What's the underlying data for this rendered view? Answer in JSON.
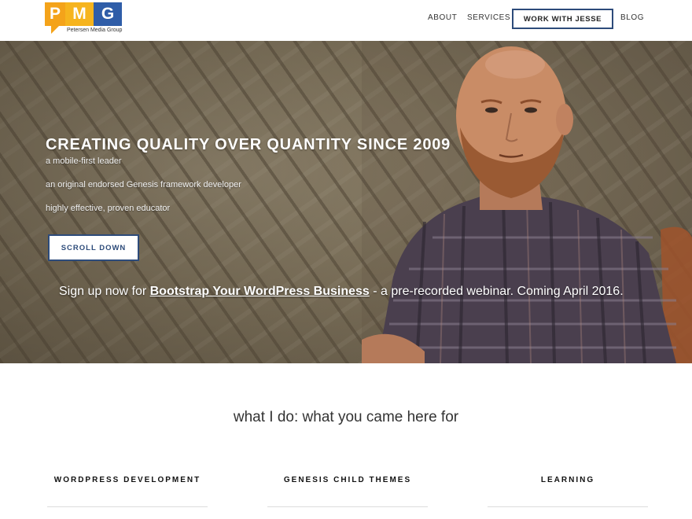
{
  "logo": {
    "letters": [
      "P",
      "M",
      "G"
    ],
    "tagline": "Petersen Media Group",
    "colors": {
      "p": "#f4a31a",
      "m": "#f6b41e",
      "g": "#2f5da8"
    }
  },
  "nav": {
    "about": "ABOUT",
    "services": "SERVICES",
    "cta": "WORK WITH JESSE",
    "blog": "BLOG"
  },
  "hero": {
    "title": "CREATING QUALITY OVER QUANTITY SINCE 2009",
    "lines": [
      "a mobile-first leader",
      "an original endorsed Genesis framework developer",
      "highly effective, proven educator"
    ],
    "scroll_button": "SCROLL DOWN",
    "signup_prefix": "Sign up now for ",
    "signup_link": "Bootstrap Your WordPress Business",
    "signup_suffix": " - a pre-recorded webinar. Coming April 2016."
  },
  "section": {
    "title": "what I do: what you came here for",
    "columns": [
      "WORDPRESS DEVELOPMENT",
      "GENESIS CHILD THEMES",
      "LEARNING"
    ]
  },
  "colors": {
    "accent": "#2d4b7a"
  }
}
